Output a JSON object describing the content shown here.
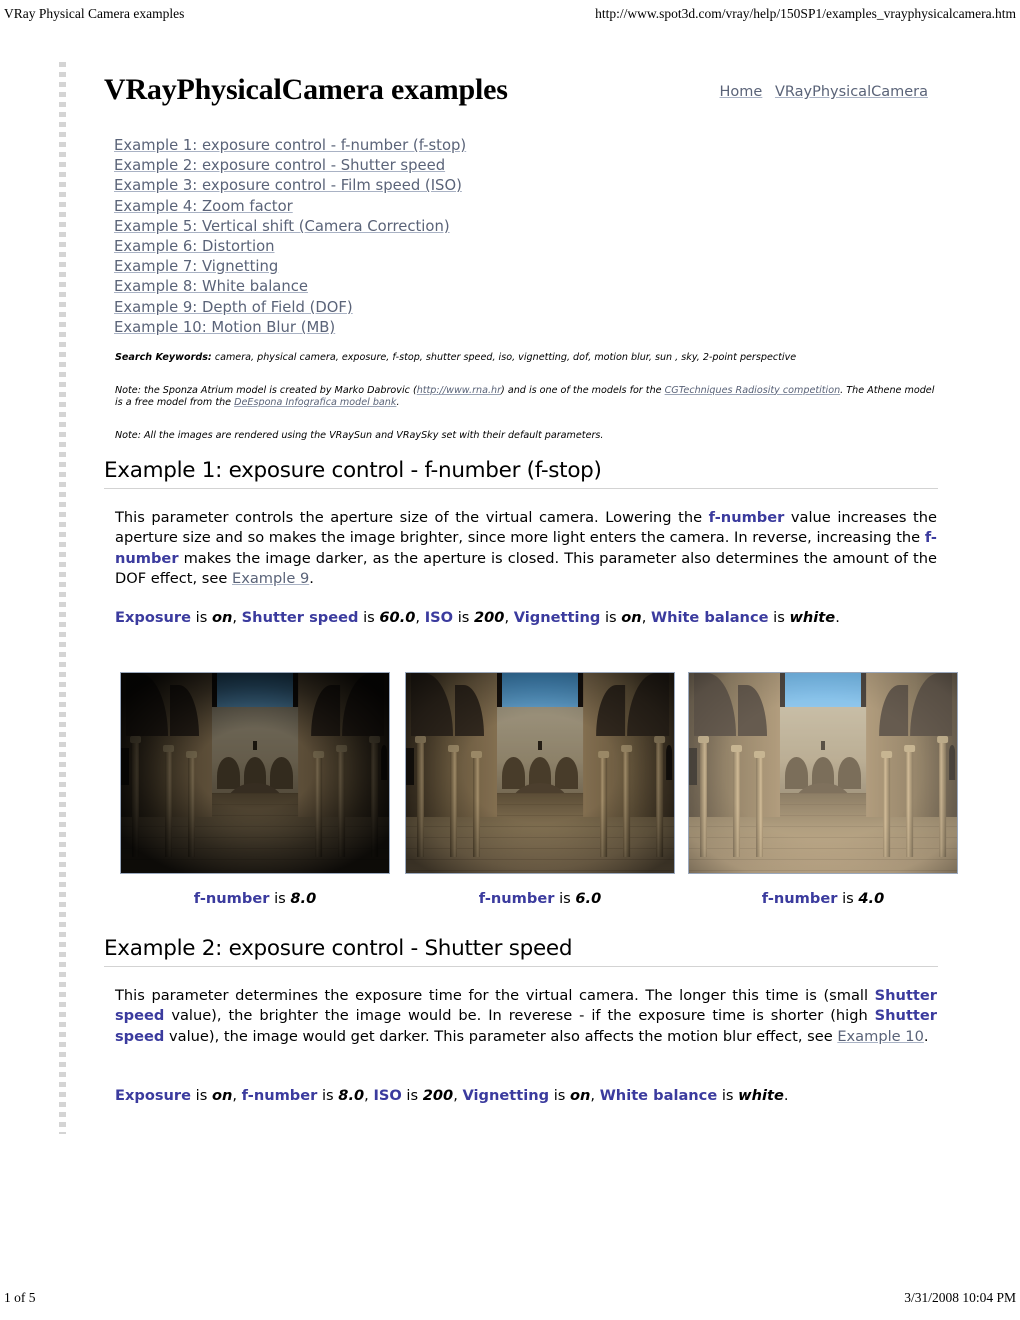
{
  "print_header": {
    "left": "VRay Physical Camera examples",
    "right": "http://www.spot3d.com/vray/help/150SP1/examples_vrayphysicalcamera.htm"
  },
  "print_footer": {
    "left": "1 of 5",
    "right": "3/31/2008 10:04 PM"
  },
  "header": {
    "title": "VRayPhysicalCamera examples",
    "nav": [
      {
        "label": "Home"
      },
      {
        "label": "VRayPhysicalCamera"
      }
    ]
  },
  "toc": [
    {
      "label": "Example 1: exposure control - f-number (f-stop)"
    },
    {
      "label": "Example 2: exposure control - Shutter speed"
    },
    {
      "label": "Example 3: exposure control - Film speed (ISO)"
    },
    {
      "label": "Example 4: Zoom factor"
    },
    {
      "label": "Example 5: Vertical shift (Camera Correction)"
    },
    {
      "label": "Example 6: Distortion"
    },
    {
      "label": "Example 7: Vignetting"
    },
    {
      "label": "Example 8: White balance"
    },
    {
      "label": "Example 9: Depth of Field (DOF)"
    },
    {
      "label": "Example 10: Motion Blur (MB)"
    }
  ],
  "meta": {
    "keywords_label": "Search Keywords:",
    "keywords_text": "camera, physical camera, exposure, f-stop, shutter speed, iso, vignetting, dof, motion blur, sun , sky, 2-point perspective",
    "note1_a": "Note: the Sponza Atrium model is created by Marko Dabrovic (",
    "note1_link1": "http://www.rna.hr",
    "note1_b": ") and is one of the models for the ",
    "note1_link2": "CGTechniques Radiosity competition",
    "note1_c": ". The Athene model is a free model from the ",
    "note1_link3": "DeEspona Infografica model bank",
    "note1_d": ".",
    "note2": "Note: All the images are rendered using the VRaySun and VRaySky set with their default parameters."
  },
  "section1": {
    "heading": "Example 1: exposure control - f-number (f-stop)",
    "para": {
      "t1": "This parameter controls the aperture size of the virtual camera. Lowering the ",
      "p1": "f-number",
      "t2": " value increases the aperture size and so makes the image brighter, since more light enters the camera. In reverse, increasing the ",
      "p2": "f-number",
      "t3": " makes the image darker, as the aperture is closed. This parameter also determines the amount of the DOF effect, see ",
      "link": "Example 9",
      "t4": "."
    },
    "settings": {
      "p1": "Exposure",
      "is1": " is ",
      "v1": "on",
      "sep1": ", ",
      "p2": "Shutter speed",
      "is2": " is ",
      "v2": "60.0",
      "sep2": ", ",
      "p3": "ISO",
      "is3": " is ",
      "v3": "200",
      "sep3": ", ",
      "p4": "Vignetting",
      "is4": " is ",
      "v4": "on",
      "sep4": ", ",
      "p5": "White balance",
      "is5": " is ",
      "v5": "white",
      "end": "."
    },
    "captions": [
      {
        "param": "f-number",
        "is": " is ",
        "value": "8.0"
      },
      {
        "param": "f-number",
        "is": " is ",
        "value": "6.0"
      },
      {
        "param": "f-number",
        "is": " is ",
        "value": "4.0"
      }
    ],
    "images": [
      {
        "alt": "Sponza atrium render, f-number 8.0, darkest"
      },
      {
        "alt": "Sponza atrium render, f-number 6.0, medium brightness"
      },
      {
        "alt": "Sponza atrium render, f-number 4.0, brightest"
      }
    ]
  },
  "section2": {
    "heading": "Example 2: exposure control - Shutter speed",
    "para": {
      "t1": "This parameter determines the exposure time for the virtual camera. The longer this time is (small ",
      "p1": "Shutter speed",
      "t2": " value), the brighter the image would be. In reverese - if the exposure time is shorter (high ",
      "p2": "Shutter speed",
      "t3": " value), the image would get darker. This parameter also affects the motion blur effect, see ",
      "link": "Example 10",
      "t4": "."
    },
    "settings": {
      "p1": "Exposure",
      "is1": " is ",
      "v1": "on",
      "sep1": ", ",
      "p2": "f-number",
      "is2": " is ",
      "v2": "8.0",
      "sep2": ", ",
      "p3": "ISO",
      "is3": " is ",
      "v3": "200",
      "sep3": ", ",
      "p4": "Vignetting",
      "is4": " is ",
      "v4": "on",
      "sep4": ", ",
      "p5": "White balance",
      "is5": " is ",
      "v5": "white",
      "end": "."
    }
  },
  "colors": {
    "param_blue": "#3b3b9e",
    "link_gray_blue": "#5a6378",
    "rule_gray": "#d3d3d3",
    "dot_gray": "#d4d4d4"
  }
}
